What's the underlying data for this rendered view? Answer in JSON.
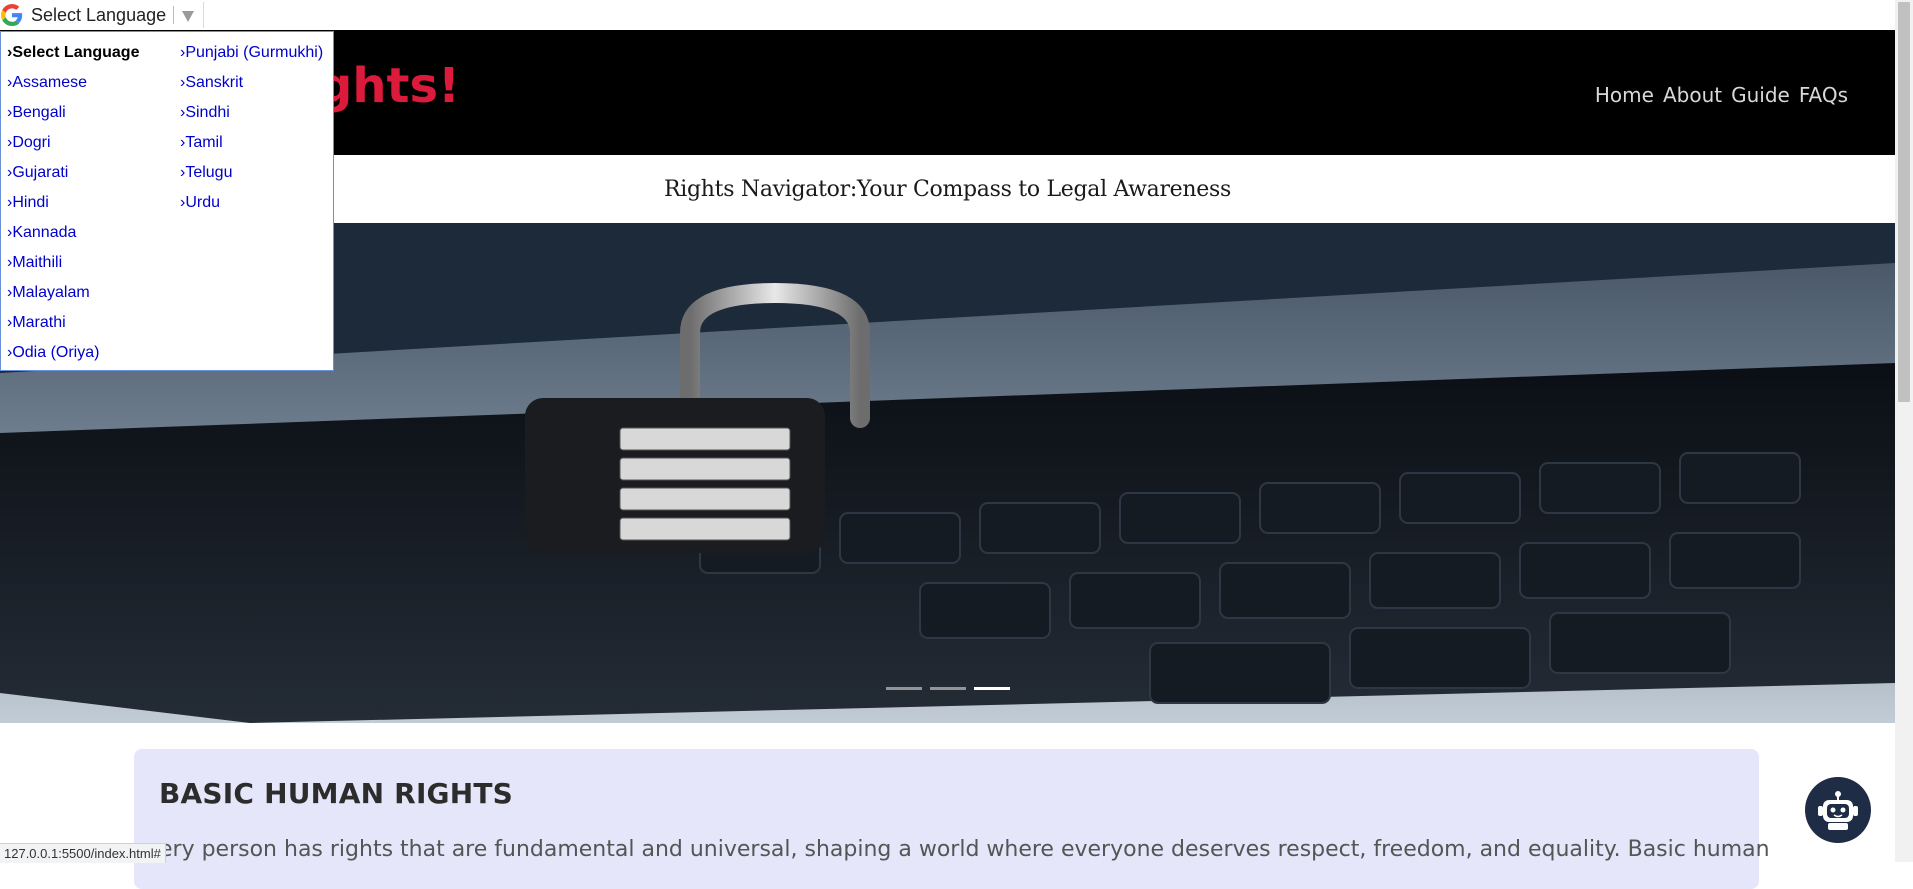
{
  "translate_bar": {
    "logo": "google-g-icon",
    "select_label": "Select Language",
    "menu": {
      "column1": [
        "Select Language",
        "Assamese",
        "Bengali",
        "Dogri",
        "Gujarati",
        "Hindi",
        "Kannada",
        "Maithili",
        "Malayalam",
        "Marathi",
        "Odia (Oriya)"
      ],
      "column2": [
        "Punjabi (Gurmukhi)",
        "Sanskrit",
        "Sindhi",
        "Tamil",
        "Telugu",
        "Urdu"
      ],
      "selected": "Select Language",
      "bullet": "›"
    }
  },
  "header": {
    "brand_visible_text": "ghts!",
    "nav": [
      "Home",
      "About",
      "Guide",
      "FAQs"
    ],
    "brand_color": "#dc1a3c"
  },
  "tagline": "Rights Navigator:Your Compass to Legal Awareness",
  "carousel": {
    "image_subject": "padlock on laptop keyboard",
    "prev_icon": "chevron-left-icon",
    "next_icon": "chevron-right-icon",
    "slides": 3,
    "active_slide": 3
  },
  "rights_section": {
    "title": "BASIC HUMAN RIGHTS",
    "text": "ery person has rights that are fundamental and universal, shaping a world where everyone deserves respect, freedom, and equality. Basic human"
  },
  "chatbot": {
    "icon": "robot-icon"
  },
  "status_bar": {
    "url": "127.0.0.1:5500/index.html#"
  }
}
